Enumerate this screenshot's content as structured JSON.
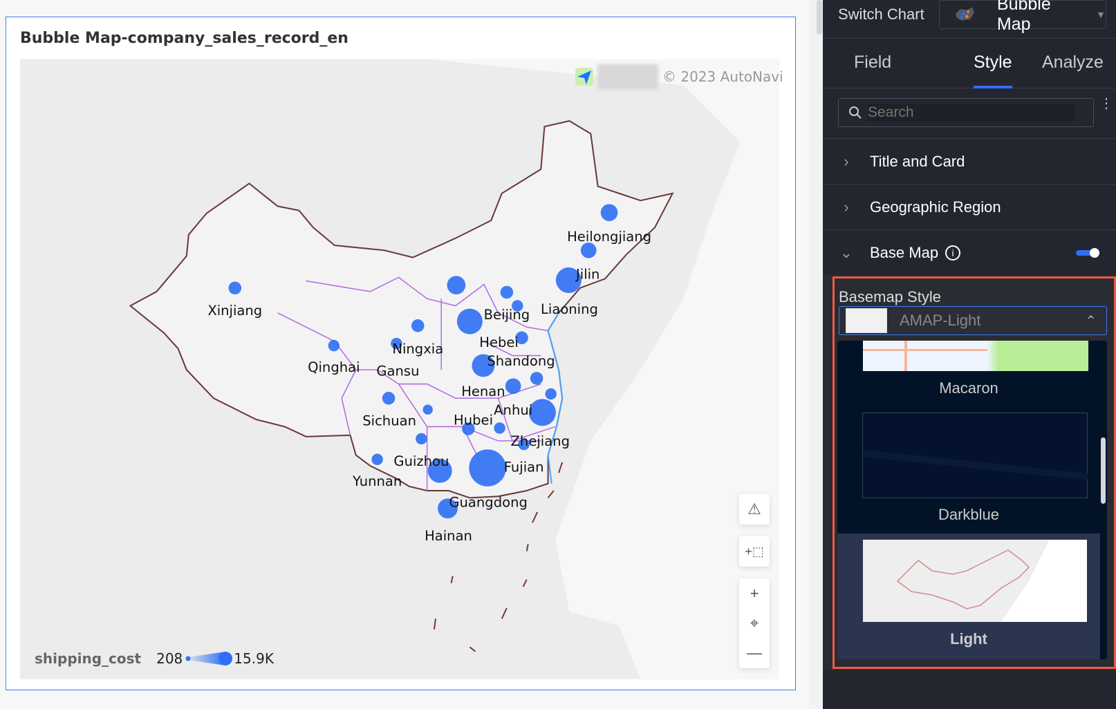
{
  "card": {
    "title": "Bubble Map-company_sales_record_en",
    "attribution": "© 2023 AutoNavi"
  },
  "map": {
    "provinces": [
      "Xinjiang",
      "Qinghai",
      "Gansu",
      "Ningxia",
      "Beijing",
      "Hebei",
      "Shandong",
      "Liaoning",
      "Jilin",
      "Heilongjiang",
      "Henan",
      "Anhui",
      "Hubei",
      "Sichuan",
      "Zhejiang",
      "Guizhou",
      "Fujian",
      "Yunnan",
      "Guangdong",
      "Hainan"
    ],
    "bubble_color": "#2f6ff5",
    "border_color": "#b36be0"
  },
  "legend": {
    "field": "shipping_cost",
    "min": "208",
    "max": "15.9K"
  },
  "controls": [
    "warning-icon",
    "select-region-icon",
    "zoom-in-icon",
    "locate-icon",
    "zoom-out-icon"
  ],
  "panel": {
    "switch_chart": "Switch Chart",
    "chart_type": "Bubble Map",
    "tabs": [
      {
        "label": "Field"
      },
      {
        "label": "Style",
        "active": true
      },
      {
        "label": "Analyze"
      }
    ],
    "search_placeholder": "Search",
    "sections": [
      {
        "label": "Title and Card",
        "expanded": false
      },
      {
        "label": "Geographic Region",
        "expanded": false
      },
      {
        "label": "Base Map",
        "expanded": true,
        "toggle": true
      }
    ],
    "basemap_style_label": "Basemap Style",
    "basemap_selected": "AMAP-Light",
    "basemap_options": [
      {
        "label": "Macaron"
      },
      {
        "label": "Darkblue"
      },
      {
        "label": "Light",
        "selected": true
      }
    ],
    "accent": "#2f6ff5",
    "highlight_border": "#f25a46"
  }
}
